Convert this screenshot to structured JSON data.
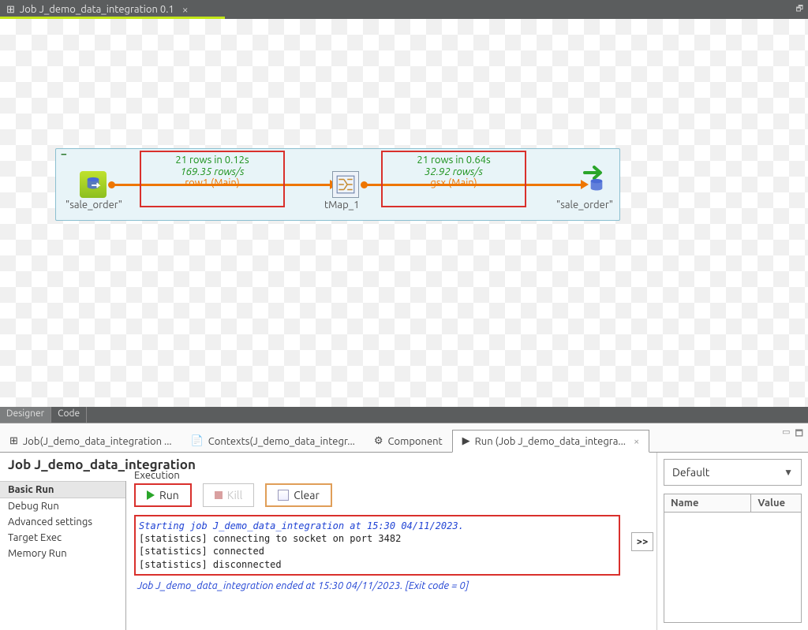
{
  "titlebar": {
    "title": "Job J_demo_data_integration 0.1"
  },
  "nodes": {
    "n1_label": "\"sale_order\"",
    "tmap_label": "tMap_1",
    "n3_label": "\"sale_order\""
  },
  "link1": {
    "stat_rows": "21 rows in 0.12s",
    "stat_rate": "169.35 rows/s",
    "name": "row1 (Main)"
  },
  "link2": {
    "stat_rows": "21 rows in 0.64s",
    "stat_rate": "32.92 rows/s",
    "name": "gsx (Main)"
  },
  "view_tabs": {
    "designer": "Designer",
    "code": "Code"
  },
  "panel_tabs": {
    "job": "Job(J_demo_data_integration ...",
    "contexts": "Contexts(J_demo_data_integr...",
    "component": "Component",
    "run": "Run (Job J_demo_data_integra..."
  },
  "bottom": {
    "title": "Job J_demo_data_integration",
    "nav": {
      "basic": "Basic Run",
      "debug": "Debug Run",
      "advanced": "Advanced settings",
      "target": "Target Exec",
      "memory": "Memory Run"
    },
    "exec_label": "Execution",
    "buttons": {
      "run": "Run",
      "kill": "Kill",
      "clear": "Clear"
    },
    "console": {
      "l1": "Starting job J_demo_data_integration at 15:30 04/11/2023.",
      "l2": "[statistics] connecting to socket on port 3482",
      "l3": "[statistics] connected",
      "l4": "[statistics] disconnected",
      "l5": "Job J_demo_data_integration ended at 15:30 04/11/2023. [Exit code  = 0]"
    },
    "expand": ">>"
  },
  "right": {
    "combo": "Default",
    "col_name": "Name",
    "col_value": "Value"
  }
}
